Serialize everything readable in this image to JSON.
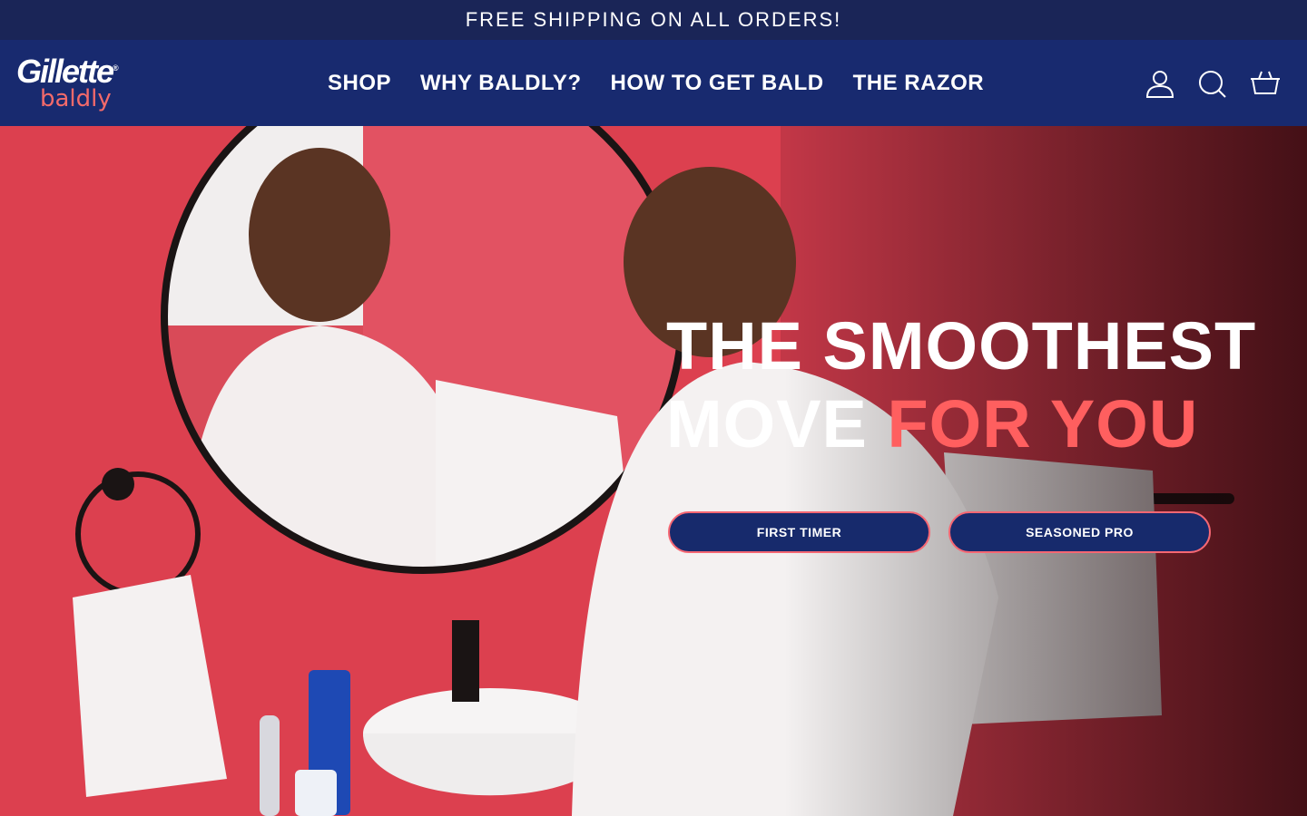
{
  "announcement": {
    "text": "FREE SHIPPING ON ALL ORDERS!"
  },
  "brand": {
    "name": "Gillette",
    "sub_name": "baldly",
    "registered_mark": "®"
  },
  "nav": {
    "items": [
      {
        "label": "SHOP"
      },
      {
        "label": "WHY BALDLY?"
      },
      {
        "label": "HOW TO GET BALD"
      },
      {
        "label": "THE RAZOR"
      }
    ]
  },
  "header_icons": [
    "account-icon",
    "search-icon",
    "cart-icon"
  ],
  "hero": {
    "headline_line1": "THE SMOOTHEST",
    "headline_line2_prefix": "MOVE ",
    "headline_line2_accent": "FOR YOU",
    "buttons": [
      {
        "label": "FIRST TIMER"
      },
      {
        "label": "SEASONED PRO"
      }
    ]
  },
  "colors": {
    "announcement_bg": "#1a2557",
    "header_bg": "#182a6f",
    "accent_red": "#ff5f5f",
    "button_bg": "#172a6c",
    "button_border": "#f56773",
    "wall_red": "#e43d4c"
  }
}
